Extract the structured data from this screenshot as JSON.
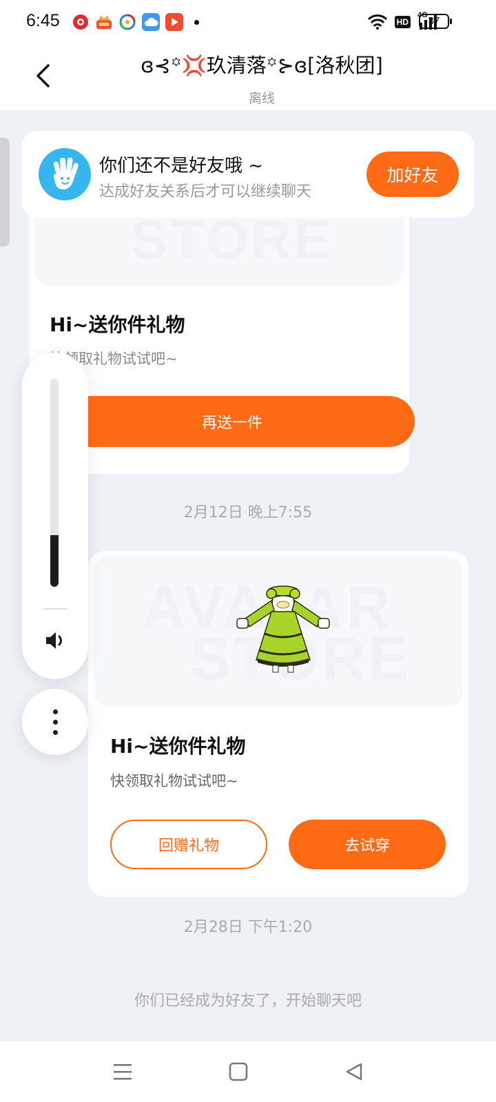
{
  "status_bar": {
    "time": "6:45",
    "app_icons": [
      "red-record-icon",
      "orange-crown-icon",
      "colorful-app-icon",
      "blue-cloud-icon",
      "red-video-icon"
    ],
    "network_badge": "HD",
    "signal_label": "4G",
    "battery_level": "37"
  },
  "header": {
    "title": "ɞ⊰꙳💢玖清落꙳⊱ɞ[洛秋团]",
    "status": "离线"
  },
  "friend_banner": {
    "title": "你们还不是好友哦 ~",
    "subtitle": "达成好友关系后才可以继续聊天",
    "add_button": "加好友"
  },
  "messages": [
    {
      "type": "gift",
      "watermark": "STORE",
      "title": "Hi~送你件礼物",
      "subtitle": "快领取礼物试试吧~",
      "button": "再送一件"
    },
    {
      "type": "timestamp",
      "text": "2月12日 晚上7:55"
    },
    {
      "type": "gift",
      "watermark_line1": "AVATAR",
      "watermark_line2": "STORE",
      "title": "Hi~送你件礼物",
      "subtitle": "快领取礼物试试吧~",
      "secondary_button": "回赠礼物",
      "primary_button": "去试穿"
    },
    {
      "type": "timestamp",
      "text": "2月28日 下午1:20"
    },
    {
      "type": "system",
      "text": "你们已经成为好友了，开始聊天吧"
    }
  ],
  "volume_panel": {
    "level": 0.25,
    "icon": "speaker-icon",
    "more_icon": "more-vertical-icon"
  },
  "colors": {
    "accent": "#ff6a14",
    "banner_icon_bg": "#36b6ef",
    "page_bg": "#eef1f5",
    "dress_green": "#a8d42a"
  },
  "nav_bar": {
    "icons": [
      "menu-icon",
      "home-square-icon",
      "back-triangle-icon"
    ]
  }
}
